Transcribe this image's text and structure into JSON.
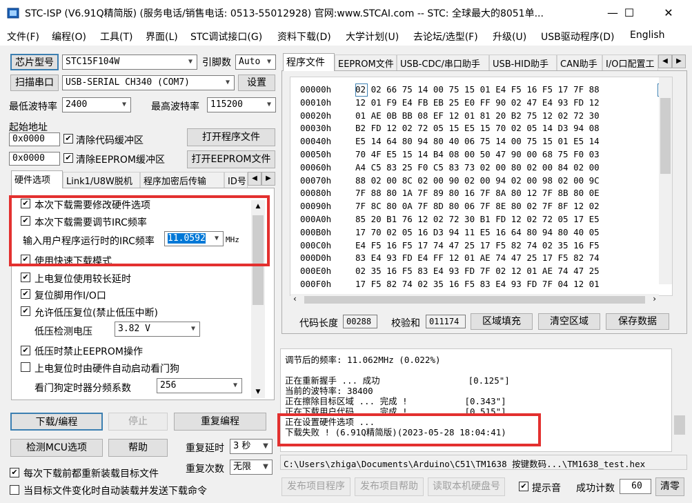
{
  "window": {
    "title": "STC-ISP (V6.91Q精简版) (服务电话/销售电话: 0513-55012928) 官网:www.STCAI.com  -- STC: 全球最大的8051单...",
    "minimize": "—",
    "maximize": "☐",
    "close": "✕"
  },
  "menu": [
    "文件(F)",
    "编程(O)",
    "工具(T)",
    "界面(L)",
    "STC调试接口(G)",
    "资料下载(D)",
    "大学计划(U)",
    "去论坛/选型(F)",
    "升级(U)",
    "USB驱动程序(D)",
    "English"
  ],
  "left": {
    "chip_label": "芯片型号",
    "chip_value": "STC15F104W",
    "pin_label": "引脚数",
    "pin_value": "Auto",
    "scan_label": "扫描串口",
    "port_value": "USB-SERIAL CH340 (COM7)",
    "settings_label": "设置",
    "min_baud_label": "最低波特率",
    "min_baud": "2400",
    "max_baud_label": "最高波特率",
    "max_baud": "115200",
    "start_addr_label": "起始地址",
    "addr1": "0x0000",
    "clear_code": "清除代码缓冲区",
    "open_prog": "打开程序文件",
    "addr2": "0x0000",
    "clear_eeprom": "清除EEPROM缓冲区",
    "open_eeprom": "打开EEPROM文件",
    "tabs": [
      "硬件选项",
      "Link1/U8W脱机",
      "程序加密后传输",
      "ID号"
    ],
    "options": {
      "opt1": "本次下载需要修改硬件选项",
      "opt2": "本次下载需要调节IRC频率",
      "irc_label": "输入用户程序运行时的IRC频率",
      "irc_value": "11.0592",
      "irc_unit": "MHz",
      "opt3": "使用快速下载模式",
      "opt4": "上电复位使用较长延时",
      "opt5": "复位脚用作I/O口",
      "opt6": "允许低压复位(禁止低压中断)",
      "lv_label": "低压检测电压",
      "lv_value": "3.82 V",
      "opt7": "低压时禁止EEPROM操作",
      "opt8": "上电复位时由硬件自动启动看门狗",
      "wdt_label": "看门狗定时器分频系数",
      "wdt_value": "256"
    },
    "download": "下载/编程",
    "stop": "停止",
    "repeat": "重复编程",
    "detect": "检测MCU选项",
    "help": "帮助",
    "repeat_delay_label": "重复延时",
    "repeat_delay": "3 秒",
    "repeat_count_label": "重复次数",
    "repeat_count": "无限",
    "reload_each": "每次下载前都重新装载目标文件",
    "auto_reload": "当目标文件变化时自动装载并发送下载命令"
  },
  "right": {
    "tabs": [
      "程序文件",
      "EEPROM文件",
      "USB-CDC/串口助手",
      "USB-HID助手",
      "CAN助手",
      "I/O口配置工"
    ],
    "hex": [
      {
        "addr": "00000h",
        "bytes": "02 02 66 75 14 00 75 15 01 E4 F5 16 F5 17 7F 88"
      },
      {
        "addr": "00010h",
        "bytes": "12 01 F9 E4 FB EB 25 E0 FF 90 02 47 E4 93 FD 12"
      },
      {
        "addr": "00020h",
        "bytes": "01 AE 0B BB 08 EF 12 01 81 20 B2 75 12 02 72 30"
      },
      {
        "addr": "00030h",
        "bytes": "B2 FD 12 02 72 05 15 E5 15 70 02 05 14 D3 94 08"
      },
      {
        "addr": "00040h",
        "bytes": "E5 14 64 80 94 80 40 06 75 14 00 75 15 01 E5 14"
      },
      {
        "addr": "00050h",
        "bytes": "70 4F E5 15 14 B4 08 00 50 47 90 00 68 75 F0 03"
      },
      {
        "addr": "00060h",
        "bytes": "A4 C5 83 25 F0 C5 83 73 02 00 80 02 00 84 02 00"
      },
      {
        "addr": "00070h",
        "bytes": "88 02 00 8C 02 00 90 02 00 94 02 00 98 02 00 9C"
      },
      {
        "addr": "00080h",
        "bytes": "7F 88 80 1A 7F 89 80 16 7F 8A 80 12 7F 8B 80 0E"
      },
      {
        "addr": "00090h",
        "bytes": "7F 8C 80 0A 7F 8D 80 06 7F 8E 80 02 7F 8F 12 02"
      },
      {
        "addr": "000A0h",
        "bytes": "85 20 B1 76 12 02 72 30 B1 FD 12 02 72 05 17 E5"
      },
      {
        "addr": "000B0h",
        "bytes": "17 70 02 05 16 D3 94 11 E5 16 64 80 94 80 40 05"
      },
      {
        "addr": "000C0h",
        "bytes": "E4 F5 16 F5 17 74 47 25 17 F5 82 74 02 35 16 F5"
      },
      {
        "addr": "000D0h",
        "bytes": "83 E4 93 FD E4 FF 12 01 AE 74 47 25 17 F5 82 74"
      },
      {
        "addr": "000E0h",
        "bytes": "02 35 16 F5 83 E4 93 FD 7F 02 12 01 AE 74 47 25"
      },
      {
        "addr": "000F0h",
        "bytes": "17 F5 82 74 02 35 16 F5 83 E4 93 FD 7F 04 12 01"
      }
    ],
    "code_len_label": "代码长度",
    "code_len": "00288",
    "checksum_label": "校验和",
    "checksum": "011174",
    "fill": "区域填充",
    "clear": "清空区域",
    "save": "保存数据",
    "log": [
      "调节后的频率: 11.062MHz (0.022%)",
      "",
      "正在重新握手 ... 成功                 [0.125\"]",
      "当前的波特率: 38400",
      "正在擦除目标区域 ... 完成 !           [0.343\"]",
      "正在下载用户代码 ... 完成 !           [0.515\"]",
      "正在设置硬件选项 ...",
      "下载失败 ! (6.91Q精简版)(2023-05-28 18:04:41)"
    ],
    "path": "C:\\Users\\zhiga\\Documents\\Arduino\\C51\\TM1638 按键数码...\\TM1638_test.hex",
    "publish_prog": "发布项目程序",
    "publish_help": "发布项目帮助",
    "read_disk": "读取本机硬盘号",
    "beep": "提示音",
    "success_label": "成功计数",
    "success_count": "60",
    "reset": "清零"
  }
}
